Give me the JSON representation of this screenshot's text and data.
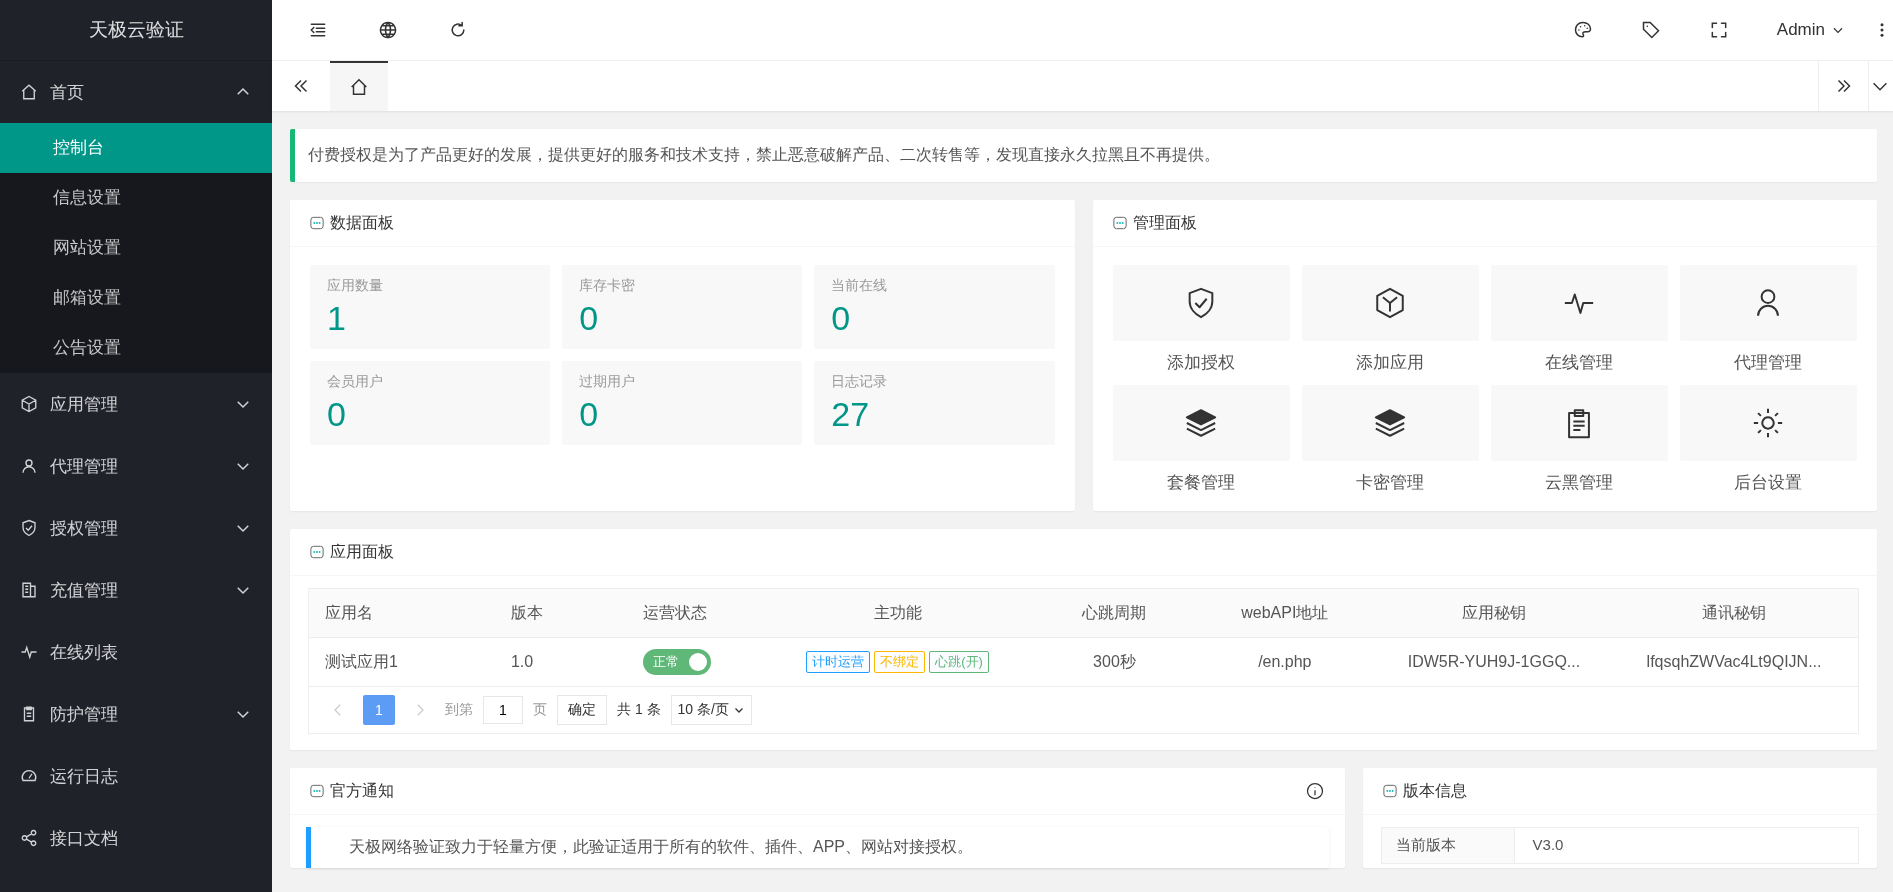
{
  "sidebar": {
    "logo": "天极云验证",
    "menu": [
      {
        "kind": "group",
        "label": "首页",
        "expanded": true,
        "children": [
          {
            "label": "控制台",
            "selected": true
          },
          {
            "label": "信息设置",
            "selected": false
          },
          {
            "label": "网站设置",
            "selected": false
          },
          {
            "label": "邮箱设置",
            "selected": false
          },
          {
            "label": "公告设置",
            "selected": false
          }
        ]
      },
      {
        "kind": "group",
        "label": "应用管理",
        "expanded": false
      },
      {
        "kind": "group",
        "label": "代理管理",
        "expanded": false
      },
      {
        "kind": "group",
        "label": "授权管理",
        "expanded": false
      },
      {
        "kind": "group",
        "label": "充值管理",
        "expanded": false
      },
      {
        "kind": "link",
        "label": "在线列表"
      },
      {
        "kind": "group",
        "label": "防护管理",
        "expanded": false
      },
      {
        "kind": "link",
        "label": "运行日志"
      },
      {
        "kind": "link",
        "label": "接口文档"
      }
    ]
  },
  "header": {
    "user": "Admin"
  },
  "tabs": [
    {
      "selected": true
    }
  ],
  "notice": "付费授权是为了产品更好的发展，提供更好的服务和技术支持，禁止恶意破解产品、二次转售等，发现直接永久拉黑且不再提供。",
  "data_panel": {
    "title": "数据面板",
    "stats": [
      {
        "label": "应用数量",
        "value": "1"
      },
      {
        "label": "库存卡密",
        "value": "0"
      },
      {
        "label": "当前在线",
        "value": "0"
      },
      {
        "label": "会员用户",
        "value": "0"
      },
      {
        "label": "过期用户",
        "value": "0"
      },
      {
        "label": "日志记录",
        "value": "27"
      }
    ]
  },
  "manage_panel": {
    "title": "管理面板",
    "tiles": [
      "添加授权",
      "添加应用",
      "在线管理",
      "代理管理",
      "套餐管理",
      "卡密管理",
      "云黑管理",
      "后台设置"
    ]
  },
  "app_panel": {
    "title": "应用面板",
    "table": {
      "columns": [
        "应用名",
        "版本",
        "运营状态",
        "主功能",
        "心跳周期",
        "webAPI地址",
        "应用秘钥",
        "通讯秘钥"
      ],
      "rows": [
        {
          "name": "测试应用1",
          "version": "1.0",
          "status": {
            "label": "正常",
            "on": true
          },
          "features": [
            {
              "label": "计时运营",
              "color": "#1e9fff"
            },
            {
              "label": "不绑定",
              "color": "#ffb800"
            },
            {
              "label": "心跳(开)",
              "color": "#5fb878"
            }
          ],
          "heartbeat": "300秒",
          "api": "/en.php",
          "app_key": "IDW5R-YUH9J-1GGQ...",
          "comm_key": "lfqsqhZWVac4Lt9QIJN..."
        }
      ]
    },
    "pagination": {
      "prev_disabled": true,
      "next_disabled": true,
      "pages": [
        {
          "label": "1",
          "selected": true
        }
      ],
      "goto_label": "到第",
      "goto_value": "1",
      "page_unit": "页",
      "confirm": "确定",
      "total": "共 1 条",
      "page_size": "10 条/页"
    }
  },
  "official_notice": {
    "title": "官方通知",
    "message": "天极网络验证致力于轻量方便，此验证适用于所有的软件、插件、APP、网站对接授权。"
  },
  "version_panel": {
    "title": "版本信息",
    "rows": [
      {
        "label": "当前版本",
        "value": "V3.0"
      }
    ]
  }
}
